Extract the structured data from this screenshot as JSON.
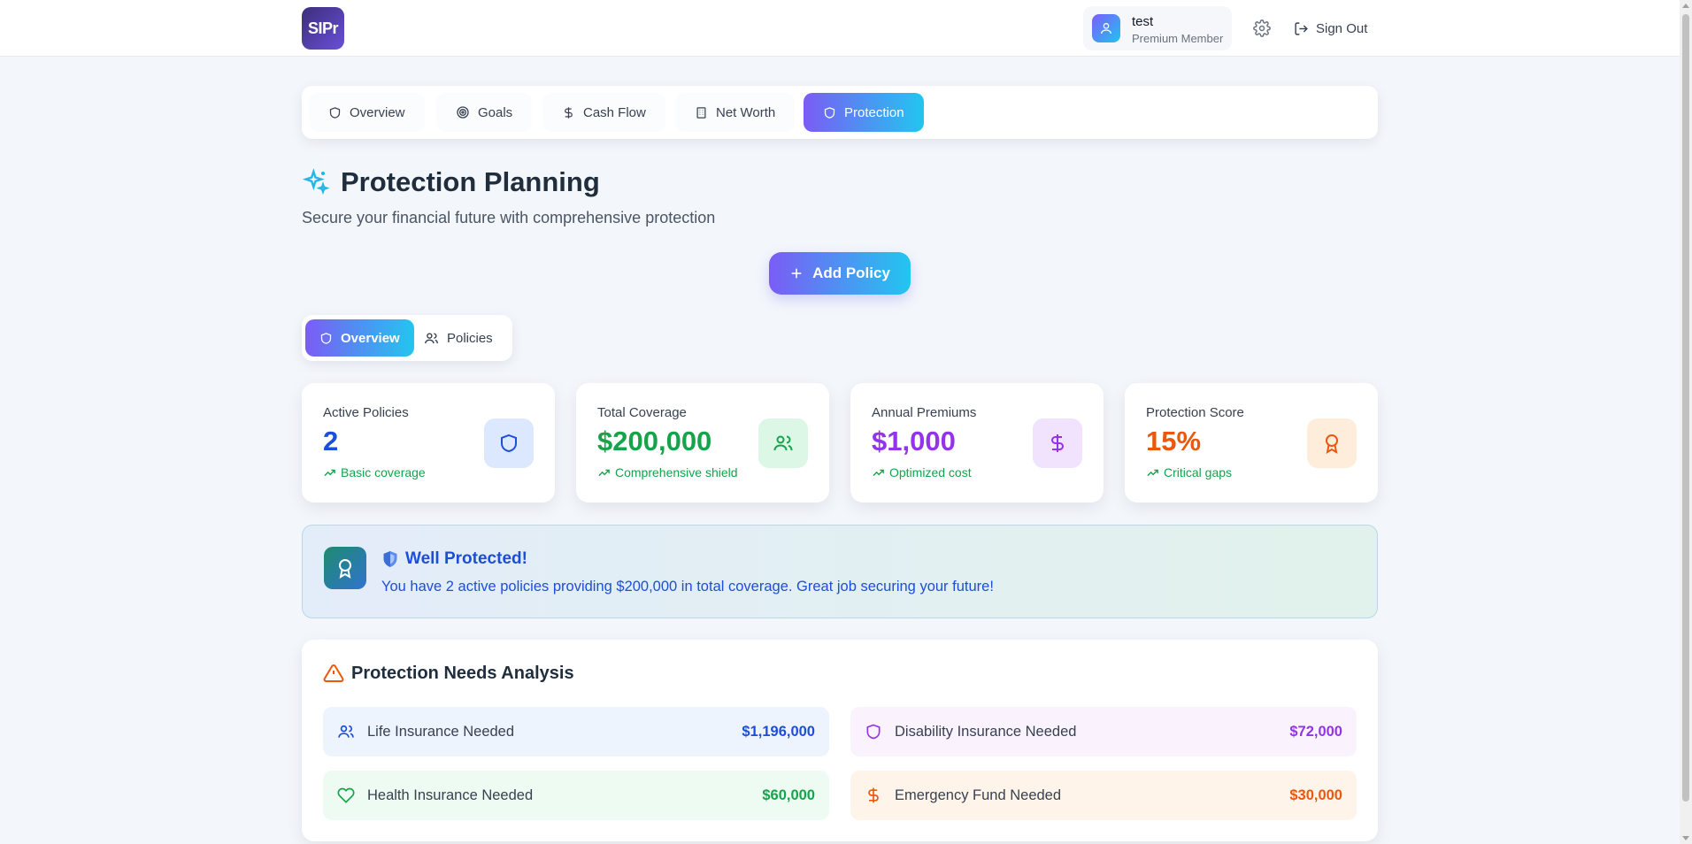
{
  "header": {
    "logo_text": "SIPr",
    "user": {
      "name": "test",
      "role": "Premium Member"
    },
    "signout_label": "Sign Out"
  },
  "nav": {
    "tabs": [
      {
        "label": "Overview",
        "icon": "shield-icon"
      },
      {
        "label": "Goals",
        "icon": "target-icon"
      },
      {
        "label": "Cash Flow",
        "icon": "dollar-icon"
      },
      {
        "label": "Net Worth",
        "icon": "building-icon"
      },
      {
        "label": "Protection",
        "icon": "shield-icon",
        "active": true
      }
    ]
  },
  "page": {
    "title": "Protection Planning",
    "subtitle": "Secure your financial future with comprehensive protection",
    "add_policy_label": "Add Policy"
  },
  "sub_tabs": [
    {
      "label": "Overview",
      "icon": "shield-icon",
      "active": true
    },
    {
      "label": "Policies",
      "icon": "users-icon"
    }
  ],
  "stats": [
    {
      "label": "Active Policies",
      "value": "2",
      "trend": "Basic coverage",
      "color": "#1d4ed8",
      "icon": "shield-icon"
    },
    {
      "label": "Total Coverage",
      "value": "$200,000",
      "trend": "Comprehensive shield",
      "color": "#16a34a",
      "icon": "users-icon"
    },
    {
      "label": "Annual Premiums",
      "value": "$1,000",
      "trend": "Optimized cost",
      "color": "#9333ea",
      "icon": "dollar-icon"
    },
    {
      "label": "Protection Score",
      "value": "15%",
      "trend": "Critical gaps",
      "color": "#ea580c",
      "icon": "award-icon"
    }
  ],
  "banner": {
    "title": "Well Protected!",
    "text": "You have 2 active policies providing $200,000 in total coverage. Great job securing your future!"
  },
  "needs": {
    "title": "Protection Needs Analysis",
    "items": [
      {
        "label": "Life Insurance Needed",
        "amount": "$1,196,000",
        "color": "#1d4ed8",
        "icon": "users-icon"
      },
      {
        "label": "Disability Insurance Needed",
        "amount": "$72,000",
        "color": "#9333ea",
        "icon": "shield-icon"
      },
      {
        "label": "Health Insurance Needed",
        "amount": "$60,000",
        "color": "#16a34a",
        "icon": "heart-icon"
      },
      {
        "label": "Emergency Fund Needed",
        "amount": "$30,000",
        "color": "#ea580c",
        "icon": "dollar-icon"
      }
    ]
  }
}
